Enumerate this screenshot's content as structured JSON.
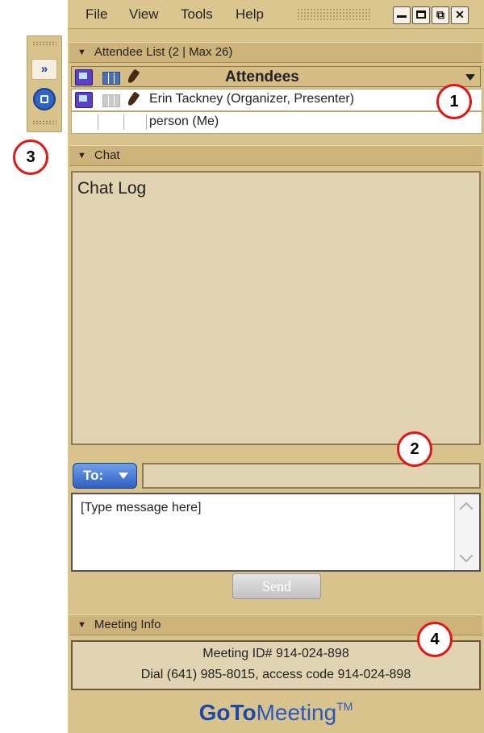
{
  "menubar": {
    "items": [
      "File",
      "View",
      "Tools",
      "Help"
    ],
    "window_buttons": [
      "minimize",
      "maximize",
      "pop-out",
      "close"
    ]
  },
  "sidebar": {
    "buttons": [
      {
        "name": "show-panel-arrows",
        "glyph": "»"
      },
      {
        "name": "screen-icon",
        "glyph": ""
      }
    ]
  },
  "attendee_list": {
    "header": "Attendee List   (2 | Max 26)",
    "column_title": "Attendees",
    "rows": [
      {
        "name": "Erin Tackney (Organizer, Presenter)"
      },
      {
        "name": "person (Me)"
      }
    ]
  },
  "chat": {
    "header": "Chat",
    "log_label": "Chat Log",
    "to_label": "To:",
    "to_value": "",
    "message_placeholder": "[Type message here]",
    "send_label": "Send"
  },
  "meeting_info": {
    "header": "Meeting Info",
    "line1": "Meeting ID# 914-024-898",
    "line2": "Dial (641) 985-8015, access code 914-024-898"
  },
  "logo": {
    "bold": "GoTo",
    "light": "Meeting",
    "tm": "TM"
  },
  "callouts": [
    "1",
    "2",
    "3",
    "4"
  ],
  "colors": {
    "panel": "#d9c38c",
    "header": "#cdb27a",
    "callout_ring": "#e01616",
    "brand_blue": "#1d47a8"
  }
}
